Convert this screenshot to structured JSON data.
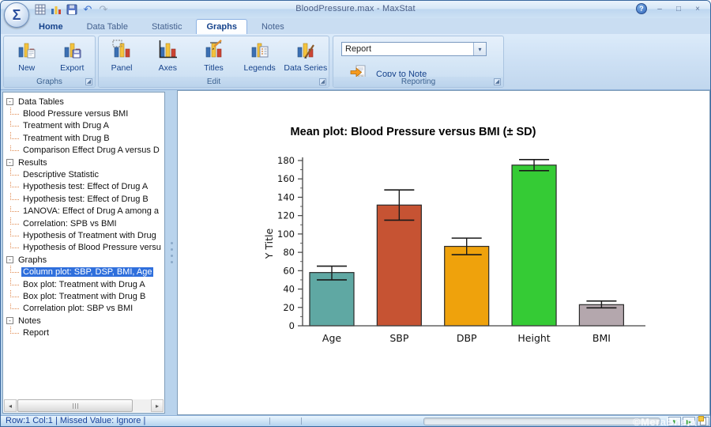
{
  "window": {
    "title": "BloodPressure.max - MaxStat"
  },
  "icons": {
    "app_logo": "Σ",
    "help": "?",
    "minimize": "–",
    "maximize": "□",
    "close": "×",
    "undo": "↶",
    "redo": "↷",
    "combo_dropdown": "▾",
    "launcher": "◢",
    "scroll_left": "◂",
    "scroll_right": "▸",
    "status_down_arrow": "▼",
    "status_right_arrow": "▶",
    "expand_collapse": "-"
  },
  "tabs": {
    "items": [
      {
        "label": "Home"
      },
      {
        "label": "Data Table"
      },
      {
        "label": "Statistic"
      },
      {
        "label": "Graphs",
        "active": true
      },
      {
        "label": "Notes"
      }
    ]
  },
  "ribbon": {
    "graphs_group": {
      "label": "Graphs",
      "buttons": {
        "new": "New",
        "export": "Export"
      }
    },
    "edit_group": {
      "label": "Edit",
      "buttons": {
        "panel": "Panel",
        "axes": "Axes",
        "titles": "Titles",
        "legends": "Legends",
        "data_series": "Data Series"
      }
    },
    "reporting_group": {
      "label": "Reporting",
      "report_combo_value": "Report",
      "copy_to_note_label": "Copy to Note"
    }
  },
  "tree": {
    "nodes": [
      {
        "label": "Data Tables",
        "level": 0
      },
      {
        "label": "Blood Pressure versus BMI",
        "level": 1
      },
      {
        "label": "Treatment with Drug A",
        "level": 1
      },
      {
        "label": "Treatment with Drug B",
        "level": 1
      },
      {
        "label": "Comparison Effect Drug A versus D",
        "level": 1
      },
      {
        "label": "Results",
        "level": 0
      },
      {
        "label": "Descriptive Statistic",
        "level": 1
      },
      {
        "label": "Hypothesis test: Effect of Drug A",
        "level": 1
      },
      {
        "label": "Hypothesis test: Effect of Drug B",
        "level": 1
      },
      {
        "label": "1ANOVA: Effect of Drug A among a",
        "level": 1
      },
      {
        "label": "Correlation: SPB vs BMI",
        "level": 1
      },
      {
        "label": "Hypothesis of Treatment with Drug",
        "level": 1
      },
      {
        "label": "Hypothesis of Blood Pressure versu",
        "level": 1
      },
      {
        "label": "Graphs",
        "level": 0
      },
      {
        "label": "Column plot: SBP, DSP, BMI, Age",
        "level": 1,
        "selected": true
      },
      {
        "label": "Box plot: Treatment with Drug A",
        "level": 1
      },
      {
        "label": "Box plot: Treatment with Drug B",
        "level": 1
      },
      {
        "label": "Correlation plot: SBP vs BMI",
        "level": 1
      },
      {
        "label": "Notes",
        "level": 0
      },
      {
        "label": "Report",
        "level": 1
      }
    ]
  },
  "chart_data": {
    "type": "bar",
    "title": "Mean plot: Blood Pressure versus BMI (± SD)",
    "xlabel": "",
    "ylabel": "Y Title",
    "categories": [
      "Age",
      "SBP",
      "DBP",
      "Height",
      "BMI"
    ],
    "values": [
      58,
      131.5,
      86.5,
      175,
      23
    ],
    "error_low": [
      50,
      115,
      77.5,
      169,
      19.5
    ],
    "error_high": [
      65,
      148,
      95.5,
      181,
      27
    ],
    "ylim": [
      0,
      180
    ],
    "ytick_step": 20,
    "minor_tick_step": 10,
    "grid": false,
    "legend_position": "none",
    "bar_colors": [
      "#5FA8A3",
      "#C65333",
      "#EFA20C",
      "#35CB35",
      "#B4A7AD"
    ],
    "bar_edge_color": "#2b2b2b",
    "error_bar_color": "#1a1a1a"
  },
  "statusbar": {
    "text": "Row:1 Col:1 | Missed Value: Ignore |"
  },
  "watermark": "©MeraBheja"
}
